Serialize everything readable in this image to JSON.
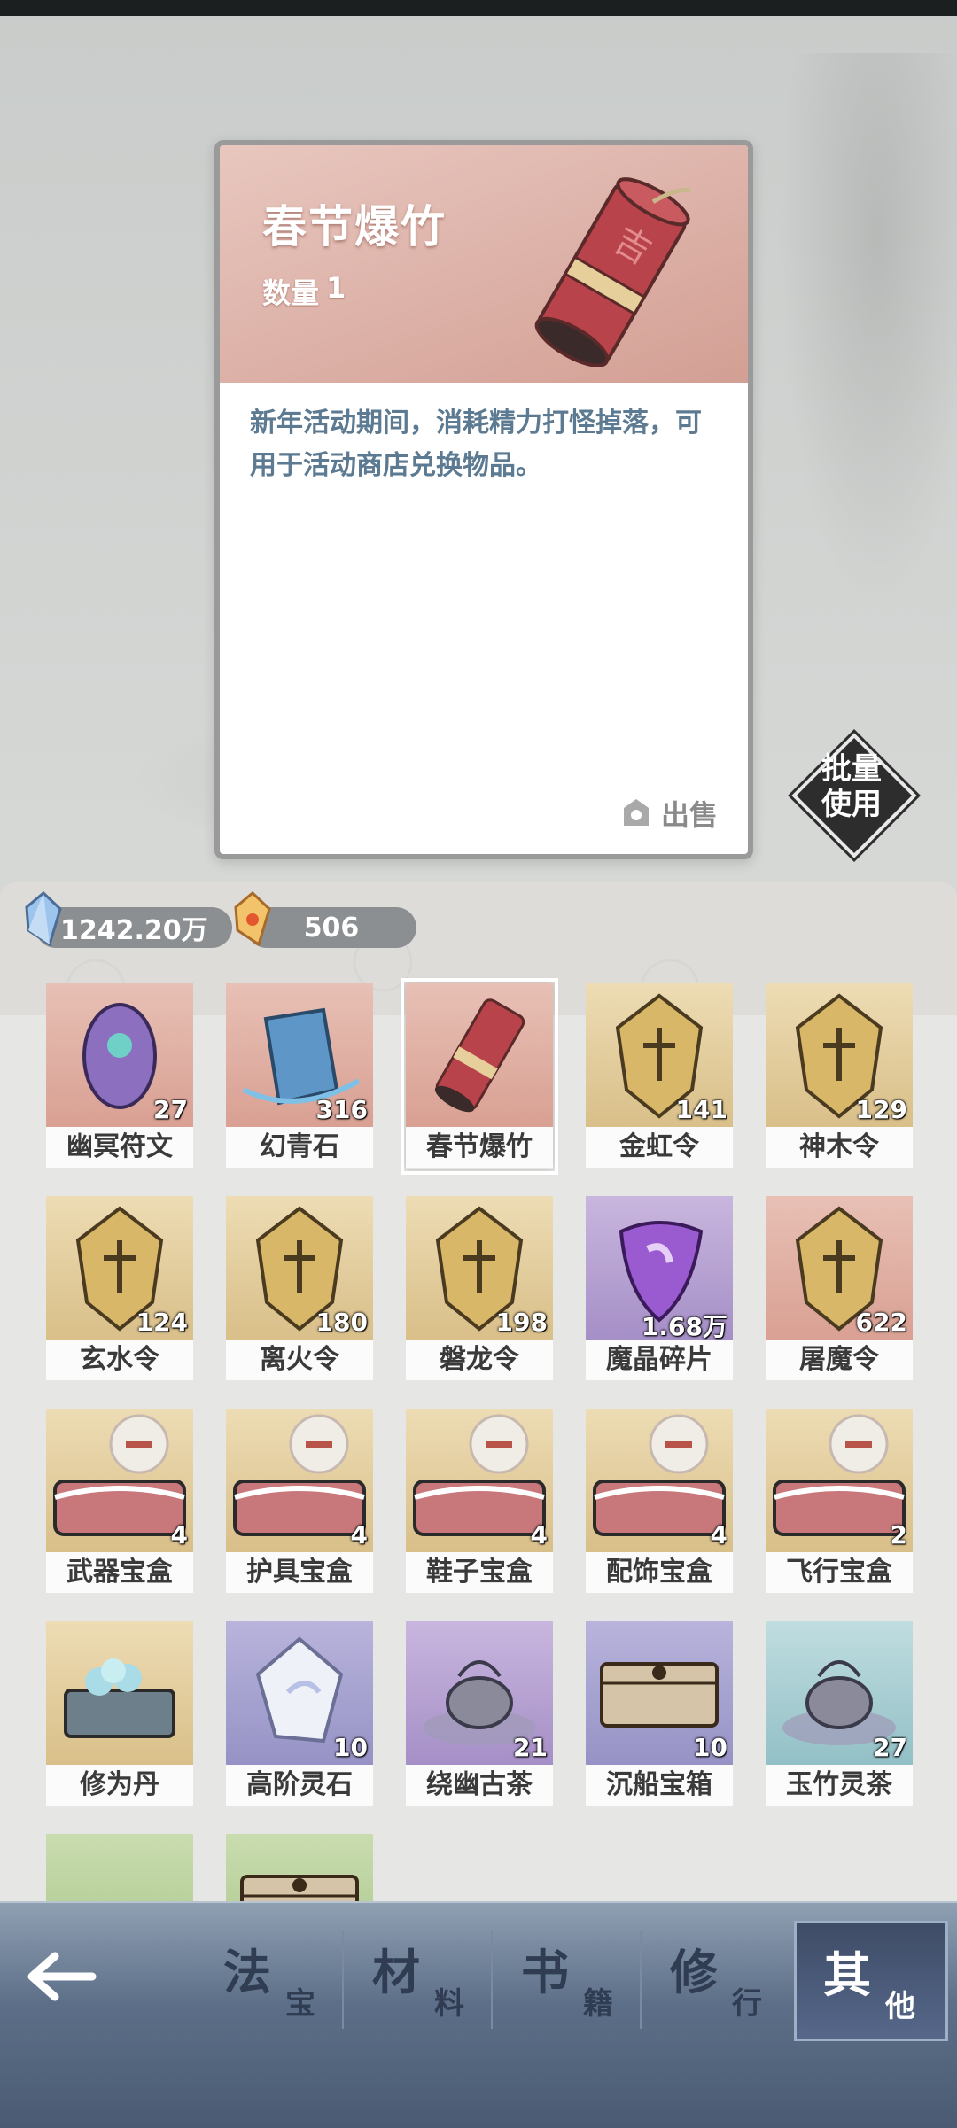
{
  "detail": {
    "title": "春节爆竹",
    "qty_label": "数量",
    "qty_value": "1",
    "description": "新年活动期间，消耗精力打怪掉落，可用于活动商店兑换物品。",
    "sell_label": "出售",
    "batch_label_1": "批量",
    "batch_label_2": "使用"
  },
  "currency": {
    "spirit_stone": "1242.20万",
    "gold_gem": "506"
  },
  "items": [
    {
      "name": "幽冥符文",
      "count": "27",
      "bg": "pink",
      "icon": "rune-icon"
    },
    {
      "name": "幻青石",
      "count": "316",
      "bg": "pink",
      "icon": "blue-stone-icon"
    },
    {
      "name": "春节爆竹",
      "count": "",
      "bg": "pink",
      "icon": "firecracker-icon",
      "selected": true
    },
    {
      "name": "金虹令",
      "count": "141",
      "bg": "tan",
      "icon": "token-icon"
    },
    {
      "name": "神木令",
      "count": "129",
      "bg": "tan",
      "icon": "token-icon"
    },
    {
      "name": "玄水令",
      "count": "124",
      "bg": "tan",
      "icon": "token-icon"
    },
    {
      "name": "离火令",
      "count": "180",
      "bg": "tan",
      "icon": "token-icon"
    },
    {
      "name": "磐龙令",
      "count": "198",
      "bg": "tan",
      "icon": "token-icon"
    },
    {
      "name": "魔晶碎片",
      "count": "1.68万",
      "bg": "purple",
      "icon": "crystal-shard-icon"
    },
    {
      "name": "屠魔令",
      "count": "622",
      "bg": "pink",
      "icon": "token-icon"
    },
    {
      "name": "武器宝盒",
      "count": "4",
      "bg": "tan",
      "icon": "treasure-box-icon"
    },
    {
      "name": "护具宝盒",
      "count": "4",
      "bg": "tan",
      "icon": "treasure-box-icon"
    },
    {
      "name": "鞋子宝盒",
      "count": "4",
      "bg": "tan",
      "icon": "treasure-box-icon"
    },
    {
      "name": "配饰宝盒",
      "count": "4",
      "bg": "tan",
      "icon": "treasure-box-icon"
    },
    {
      "name": "飞行宝盒",
      "count": "2",
      "bg": "tan",
      "icon": "treasure-box-icon"
    },
    {
      "name": "修为丹",
      "count": "",
      "bg": "tan",
      "icon": "pill-box-icon"
    },
    {
      "name": "高阶灵石",
      "count": "10",
      "bg": "lav",
      "icon": "spirit-stone-icon"
    },
    {
      "name": "绕幽古茶",
      "count": "21",
      "bg": "purple",
      "icon": "teapot-icon"
    },
    {
      "name": "沉船宝箱",
      "count": "10",
      "bg": "lav",
      "icon": "chest-icon"
    },
    {
      "name": "玉竹灵茶",
      "count": "27",
      "bg": "teal",
      "icon": "teapot-icon"
    },
    {
      "name": "",
      "count": "",
      "bg": "green",
      "icon": "bowl-icon"
    },
    {
      "name": "",
      "count": "",
      "bg": "green",
      "icon": "chest-icon"
    }
  ],
  "tabs": [
    {
      "big": "法",
      "small": "宝",
      "active": false
    },
    {
      "big": "材",
      "small": "料",
      "active": false
    },
    {
      "big": "书",
      "small": "籍",
      "active": false
    },
    {
      "big": "修",
      "small": "行",
      "active": false
    },
    {
      "big": "其",
      "small": "他",
      "active": true
    }
  ]
}
